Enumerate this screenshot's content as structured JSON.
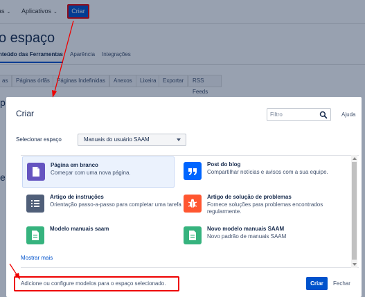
{
  "colors": {
    "accent": "#0052cc",
    "annotation": "#e00000"
  },
  "topnav": {
    "items": [
      {
        "label": "as",
        "icon": "chevron-down-icon"
      },
      {
        "label": "Aplicativos",
        "icon": "chevron-down-icon"
      }
    ],
    "create_label": "Criar"
  },
  "background": {
    "title": "o espaço",
    "tabs": [
      "nteúdo das Ferramentas",
      "Aparência",
      "Integrações"
    ],
    "subtabs": [
      "as",
      "Páginas órfãs",
      "Páginas Indefinidas",
      "Anexos",
      "Lixeira",
      "Exportar",
      "RSS Feeds"
    ],
    "side_chars": [
      "p",
      "e"
    ]
  },
  "dialog": {
    "title": "Criar",
    "filter_placeholder": "Filtro",
    "help_label": "Ajuda",
    "space_label": "Selecionar espaço",
    "space_value": "Manuais do usuário SAAM",
    "templates": [
      {
        "name": "Página em branco",
        "desc": "Começar com uma nova página.",
        "icon": "page-icon",
        "color": "#6554c0"
      },
      {
        "name": "Post do blog",
        "desc": "Compartilhar notícias e avisos com a sua equipe.",
        "icon": "quote-icon",
        "color": "#0065ff"
      },
      {
        "name": "Artigo de instruções",
        "desc": "Orientação passo-a-passo para completar uma tarefa",
        "icon": "list-icon",
        "color": "#505f79"
      },
      {
        "name": "Artigo de solução de problemas",
        "desc": "Fornece soluções para problemas encontrados regularmente.",
        "icon": "bug-icon",
        "color": "#ff5630"
      },
      {
        "name": "Modelo manuais saam",
        "desc": "",
        "icon": "document-icon",
        "color": "#36b37e"
      },
      {
        "name": "Novo modelo manuais SAAM",
        "desc": "Novo padrão de manuais SAAM",
        "icon": "document-icon",
        "color": "#36b37e"
      }
    ],
    "more_label": "Mostrar mais",
    "footer_link": "Adicione ou configure modelos para o espaço selecionado.",
    "create_button": "Criar",
    "close_button": "Fechar"
  }
}
